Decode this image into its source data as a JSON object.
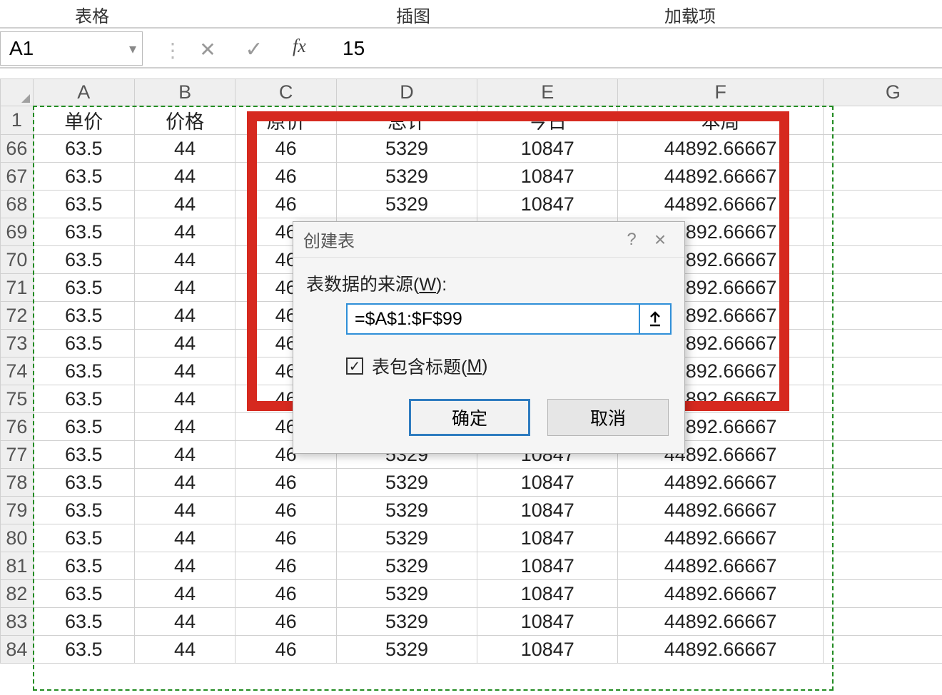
{
  "ribbon": {
    "tab1": "表格",
    "tab2": "插图",
    "tab3": "加载项"
  },
  "formula_bar": {
    "name_box": "A1",
    "fx_label": "fx",
    "value": "15"
  },
  "columns": [
    "A",
    "B",
    "C",
    "D",
    "E",
    "F",
    "G"
  ],
  "row_numbers": [
    "1",
    "66",
    "67",
    "68",
    "69",
    "70",
    "71",
    "72",
    "73",
    "74",
    "75",
    "76",
    "77",
    "78",
    "79",
    "80",
    "81",
    "82",
    "83",
    "84"
  ],
  "header_row": {
    "A": "单价",
    "B": "价格",
    "C": "原价",
    "D": "总计",
    "E": "今日",
    "F": "本周",
    "G": ""
  },
  "data_row": {
    "A": "63.5",
    "B": "44",
    "C": "46",
    "D": "5329",
    "E": "10847",
    "F": "44892.66667",
    "G": ""
  },
  "partial_row_F": "4892.66667",
  "dialog": {
    "title": "创建表",
    "help": "?",
    "close": "×",
    "source_label_pre": "表数据的来源(",
    "source_label_key": "W",
    "source_label_post": "):",
    "range_value": "=$A$1:$F$99",
    "checkbox_checked": "✓",
    "checkbox_label_pre": "表包含标题(",
    "checkbox_label_key": "M",
    "checkbox_label_post": ")",
    "ok": "确定",
    "cancel": "取消"
  }
}
